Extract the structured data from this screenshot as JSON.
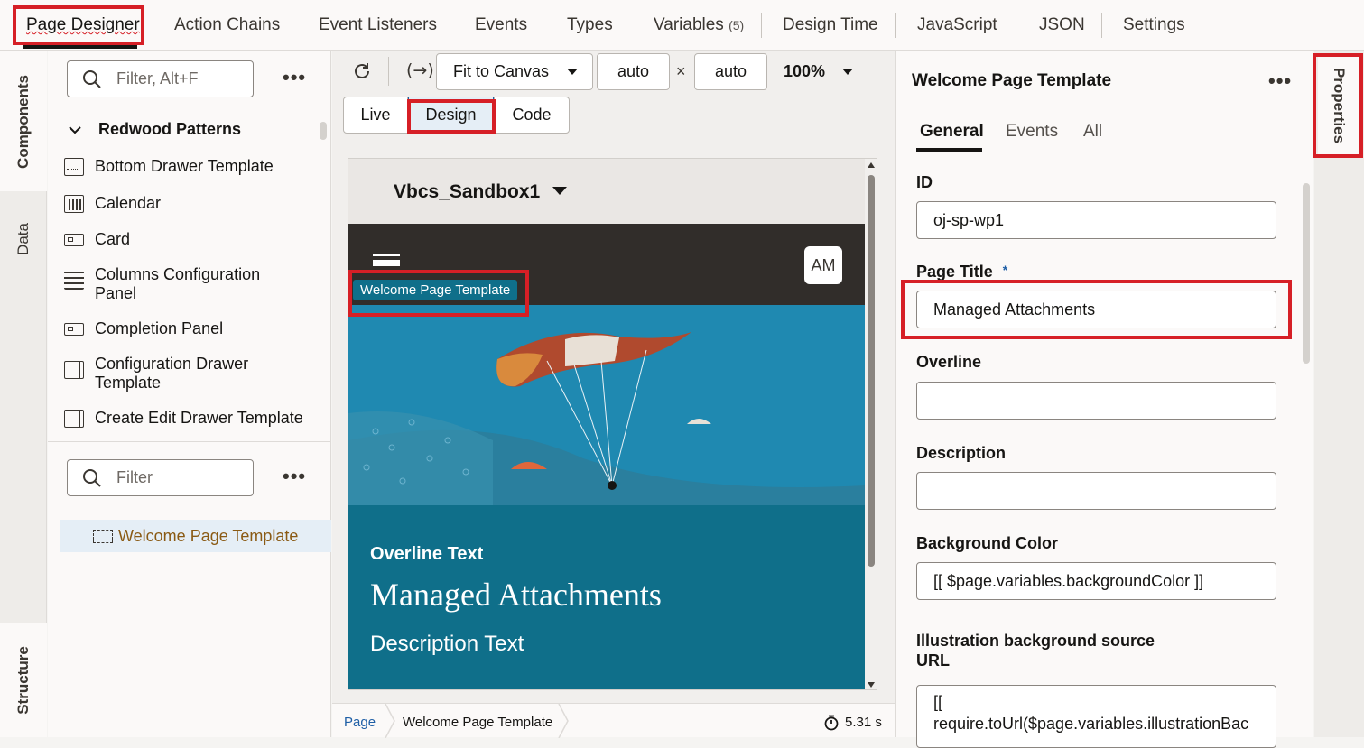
{
  "top_tabs": [
    {
      "label": "Page Designer"
    },
    {
      "label": "Action Chains"
    },
    {
      "label": "Event Listeners"
    },
    {
      "label": "Events"
    },
    {
      "label": "Types"
    },
    {
      "label": "Variables",
      "count": "(5)"
    },
    {
      "label": "Design Time"
    },
    {
      "label": "JavaScript"
    },
    {
      "label": "JSON"
    },
    {
      "label": "Settings"
    }
  ],
  "left_rail": {
    "components": "Components",
    "data": "Data",
    "structure": "Structure"
  },
  "components_panel": {
    "filter_placeholder": "Filter, Alt+F",
    "more": "•••",
    "group_label": "Redwood Patterns",
    "items": [
      {
        "label": "Bottom Drawer Template"
      },
      {
        "label": "Calendar"
      },
      {
        "label": "Card"
      },
      {
        "label": "Columns Configuration Panel"
      },
      {
        "label": "Completion Panel"
      },
      {
        "label": "Configuration Drawer Template"
      },
      {
        "label": "Create Edit Drawer Template"
      }
    ]
  },
  "structure_panel": {
    "filter_placeholder": "Filter",
    "more": "•••",
    "tree_item": "Welcome Page Template"
  },
  "canvas_toolbar": {
    "fit": "Fit to Canvas",
    "width": "auto",
    "times": "×",
    "height": "auto",
    "zoom": "100%",
    "modes": [
      "Live",
      "Design",
      "Code"
    ]
  },
  "preview": {
    "app_name": "Vbcs_Sandbox1",
    "avatar": "AM",
    "component_tag": "Welcome Page Template",
    "overline": "Overline Text",
    "title": "Managed Attachments",
    "description": "Description Text"
  },
  "footer": {
    "crumb_page": "Page",
    "crumb_component": "Welcome Page Template",
    "timing": "5.31 s"
  },
  "properties": {
    "header": "Welcome Page Template",
    "more": "•••",
    "tabs": [
      "General",
      "Events",
      "All"
    ],
    "id_label": "ID",
    "id_value": "oj-sp-wp1",
    "title_label": "Page Title",
    "required_mark": "*",
    "title_value": "Managed Attachments",
    "overline_label": "Overline",
    "overline_value": "",
    "description_label": "Description",
    "description_value": "",
    "bg_label": "Background Color",
    "bg_value": "[[ $page.variables.backgroundColor ]]",
    "illus_label_1": "Illustration background source",
    "illus_label_2": "URL",
    "illus_value_1": "[[",
    "illus_value_2": "require.toUrl($page.variables.illustrationBac"
  },
  "right_rail": {
    "properties": "Properties"
  },
  "colors": {
    "accent_red": "#d61f26",
    "teal": "#0f6f8a",
    "header_dark": "#312d2a",
    "link": "#1f5fa6",
    "brown": "#8a5a14"
  }
}
